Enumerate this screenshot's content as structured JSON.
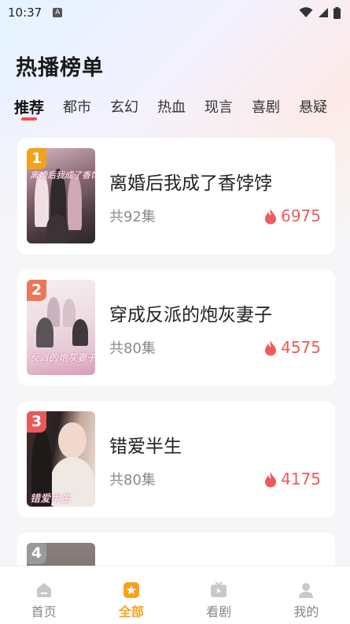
{
  "status": {
    "time": "10:37",
    "a_badge": "A"
  },
  "page": {
    "title": "热播榜单"
  },
  "tabs": [
    {
      "label": "推荐",
      "active": true
    },
    {
      "label": "都市"
    },
    {
      "label": "玄幻"
    },
    {
      "label": "热血"
    },
    {
      "label": "现言"
    },
    {
      "label": "喜剧"
    },
    {
      "label": "悬疑"
    }
  ],
  "cards": [
    {
      "rank": "1",
      "title": "离婚后我成了香饽饽",
      "episodes": "共92集",
      "hot": "6975",
      "cover_text": "离婚后我成了香饽饽",
      "badge_color": "#f3a21a"
    },
    {
      "rank": "2",
      "title": "穿成反派的炮灰妻子",
      "episodes": "共80集",
      "hot": "4575",
      "cover_text": "反派的炮灰妻子",
      "badge_color": "#e8785a"
    },
    {
      "rank": "3",
      "title": "错爱半生",
      "episodes": "共80集",
      "hot": "4175",
      "cover_text": "错爱半生",
      "badge_color": "#e85a5a"
    },
    {
      "rank": "4",
      "title": "",
      "episodes": "",
      "hot": "",
      "cover_text": "",
      "badge_color": "#9a9a9a"
    }
  ],
  "nav": [
    {
      "label": "首页",
      "icon": "home-icon"
    },
    {
      "label": "全部",
      "icon": "all-icon",
      "active": true
    },
    {
      "label": "看剧",
      "icon": "tv-icon"
    },
    {
      "label": "我的",
      "icon": "profile-icon"
    }
  ],
  "colors": {
    "accent": "#f7a21b",
    "hot": "#f05a5a",
    "tab_indicator": "#ff4a4a"
  }
}
